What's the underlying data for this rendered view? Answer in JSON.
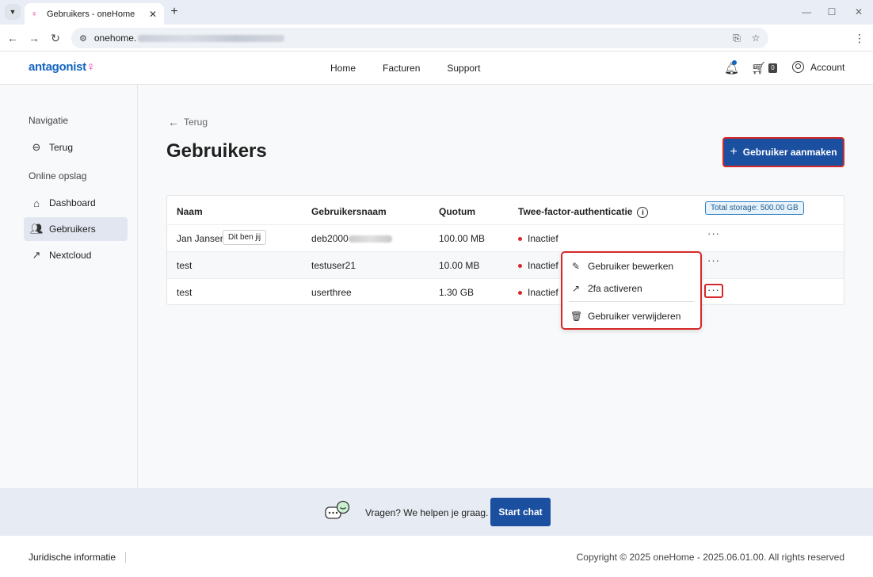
{
  "browser": {
    "tab_title": "Gebruikers - oneHome",
    "url_visible": "onehome.",
    "close_glyph": "✕",
    "new_tab_glyph": "+"
  },
  "site": {
    "logo_text": "antagonist",
    "nav": [
      "Home",
      "Facturen",
      "Support"
    ],
    "cart_count": "0",
    "account_label": "Account"
  },
  "sidebar": {
    "heading_nav": "Navigatie",
    "back_label": "Terug",
    "heading_storage": "Online opslag",
    "items": [
      {
        "label": "Dashboard",
        "icon": "home-icon"
      },
      {
        "label": "Gebruikers",
        "icon": "users-icon",
        "active": true
      },
      {
        "label": "Nextcloud",
        "icon": "external-arrow-icon"
      }
    ]
  },
  "main": {
    "back_link": "Terug",
    "title": "Gebruikers",
    "create_button": "Gebruiker aanmaken",
    "table": {
      "headers": [
        "Naam",
        "Gebruikersnaam",
        "Quotum",
        "Twee-factor-authenticatie"
      ],
      "storage_badge": "Total storage: 500.00 GB",
      "rows": [
        {
          "name": "Jan Jansen",
          "badge": "Dit ben jij",
          "username": "deb2000",
          "quota": "100.00 MB",
          "twofa": "Inactief"
        },
        {
          "name": "test",
          "username": "testuser21",
          "quota": "10.00 MB",
          "twofa": "Inactief"
        },
        {
          "name": "test",
          "username": "userthree",
          "quota": "1.30 GB",
          "twofa": "Inactief"
        }
      ]
    },
    "row_menu_glyph": "···",
    "dropdown": [
      {
        "label": "Gebruiker bewerken",
        "icon": "pencil-icon"
      },
      {
        "label": "2fa activeren",
        "icon": "arrow-up-right-icon"
      },
      {
        "label": "Gebruiker verwijderen",
        "icon": "trash-icon"
      }
    ]
  },
  "chat": {
    "text": "Vragen? We helpen je graag.",
    "button": "Start chat"
  },
  "footer": {
    "legal": "Juridische informatie",
    "copyright": "Copyright © 2025 oneHome - 2025.06.01.00. All rights reserved"
  },
  "colors": {
    "primary": "#1b4fa0",
    "highlight": "#d62828",
    "logo_accent": "#e4248f"
  }
}
